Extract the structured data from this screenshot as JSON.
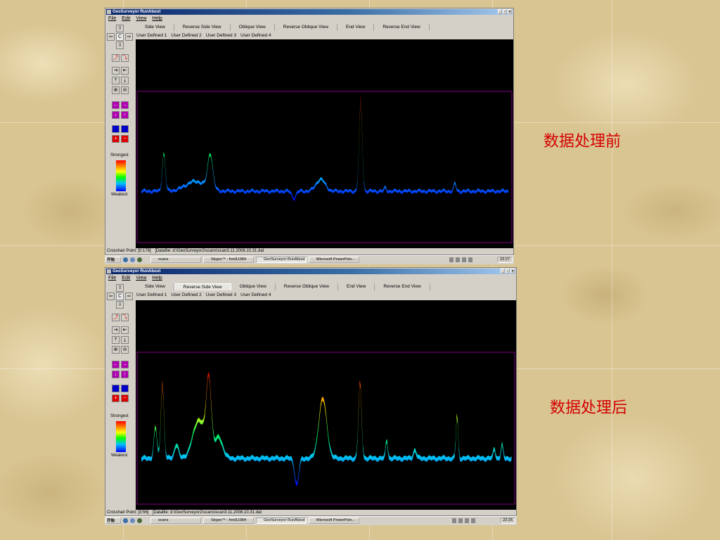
{
  "slide": {
    "caption_before": "数据处理前",
    "caption_after": "数据处理后"
  },
  "window_top": {
    "title": "GeoSurveyor RunAbout",
    "menu": [
      "File",
      "Edit",
      "View",
      "Help"
    ],
    "view_tabs": [
      "Side View",
      "Reverse Side View",
      "Oblique View",
      "Reverse Oblique View",
      "End View",
      "Reverse End View"
    ],
    "user_tabs": [
      "User Defined 1",
      "User Defined 2",
      "User Defined 3",
      "User Defined 4"
    ],
    "legend_strongest": "Strongest",
    "legend_weakest": "Weakest",
    "status_crosshair": "Crosshair Point: [0:176]",
    "status_datafile": "Datafile: d:\\GeoSurveyor2\\scans\\scan3.11.2008.10.31.dat",
    "taskbar_start": "开始",
    "taskbar_tasks": [
      "scans",
      "Skype™ - fred11984",
      "GeoSurveyor RunAbout",
      "Microsoft PowerPoin..."
    ],
    "clock": "22:27"
  },
  "window_bottom": {
    "title": "GeoSurveyor RunAbout",
    "menu": [
      "File",
      "Edit",
      "View",
      "Help"
    ],
    "view_tabs": [
      "Side View",
      "Reverse Side View",
      "Oblique View",
      "Reverse Oblique View",
      "End View",
      "Reverse End View"
    ],
    "active_tab": "Reverse Side View",
    "user_tabs": [
      "User Defined 1",
      "User Defined 2",
      "User Defined 3",
      "User Defined 4"
    ],
    "legend_strongest": "Strongest",
    "legend_weakest": "Weakest",
    "status_crosshair": "Crosshair Point: [3:56]",
    "status_datafile": "Datafile: d:\\GeoSurveyor2\\scans\\scan3.11.2008.10.31.dat",
    "taskbar_start": "开始",
    "taskbar_tasks": [
      "scans",
      "Skype™ - fred11984",
      "GeoSurveyor RunAbout",
      "Microsoft PowerPoin..."
    ],
    "clock": "22:25"
  },
  "colors": {
    "caption": "#d40000",
    "plot_background": "#000000",
    "plot_frame": "#800080"
  }
}
